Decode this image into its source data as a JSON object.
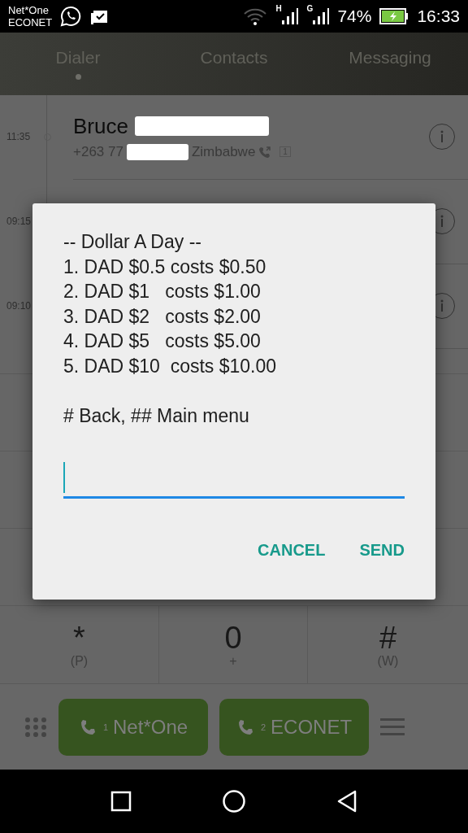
{
  "status_bar": {
    "carriers": [
      "Net*One",
      "ECONET"
    ],
    "signals": [
      {
        "label": "H"
      },
      {
        "label": "G"
      }
    ],
    "battery": "74%",
    "charging": true,
    "time": "16:33"
  },
  "tabs": [
    {
      "label": "Dialer",
      "selected": true
    },
    {
      "label": "Contacts",
      "selected": false
    },
    {
      "label": "Messaging",
      "selected": false
    }
  ],
  "call_log": [
    {
      "time": "11:35",
      "name": "Bruce",
      "number": "+263 77",
      "location": "Zimbabwe",
      "sim": "1"
    },
    {
      "time": "09:15"
    },
    {
      "time": "09:10"
    }
  ],
  "keypad": [
    {
      "key": "*",
      "sub": "(P)"
    },
    {
      "key": "0",
      "sub": "+"
    },
    {
      "key": "#",
      "sub": "(W)"
    }
  ],
  "call_buttons": [
    {
      "sim": "1",
      "label": "Net*One"
    },
    {
      "sim": "2",
      "label": "ECONET"
    }
  ],
  "dialog": {
    "paragraphs": [
      [
        "-- Dollar A Day --",
        "1. DAD $0.5 costs $0.50",
        "2. DAD $1   costs $1.00",
        "3. DAD $2   costs $2.00",
        "4. DAD $5   costs $5.00",
        "5. DAD $10  costs $10.00"
      ],
      [
        "# Back, ## Main menu"
      ]
    ],
    "input": {
      "focused": true
    },
    "buttons": [
      "CANCEL",
      "SEND"
    ]
  }
}
